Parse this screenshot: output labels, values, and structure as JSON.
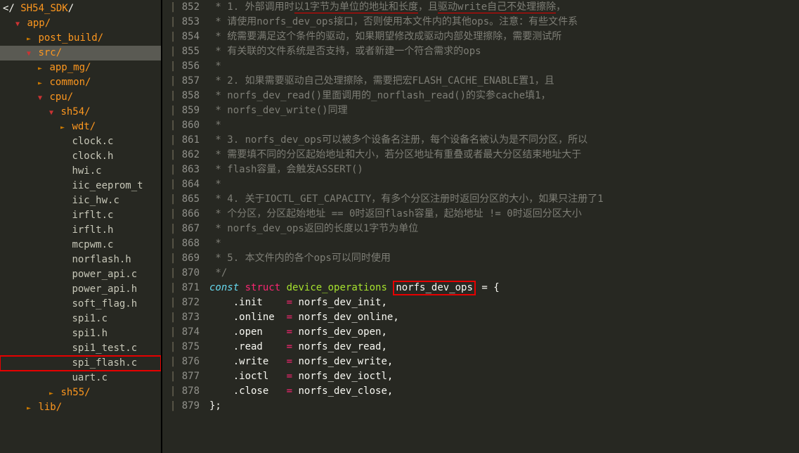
{
  "sidebar": {
    "root": "SH54_SDK",
    "root_prefix": "</ ",
    "root_suffix": "/",
    "items": [
      {
        "depth": 1,
        "arrow": "open",
        "kind": "dir",
        "label": "app/"
      },
      {
        "depth": 2,
        "arrow": "closed",
        "kind": "dir",
        "label": "post_build/"
      },
      {
        "depth": 2,
        "arrow": "open",
        "kind": "dir",
        "label": "src/",
        "selected": true
      },
      {
        "depth": 3,
        "arrow": "closed",
        "kind": "dir",
        "label": "app_mg/"
      },
      {
        "depth": 3,
        "arrow": "closed",
        "kind": "dir",
        "label": "common/"
      },
      {
        "depth": 3,
        "arrow": "open",
        "kind": "dir",
        "label": "cpu/"
      },
      {
        "depth": 4,
        "arrow": "open",
        "kind": "dir",
        "label": "sh54/"
      },
      {
        "depth": 5,
        "arrow": "closed",
        "kind": "dir",
        "label": "wdt/"
      },
      {
        "depth": 5,
        "arrow": "none",
        "kind": "file",
        "label": "clock.c"
      },
      {
        "depth": 5,
        "arrow": "none",
        "kind": "file",
        "label": "clock.h"
      },
      {
        "depth": 5,
        "arrow": "none",
        "kind": "file",
        "label": "hwi.c"
      },
      {
        "depth": 5,
        "arrow": "none",
        "kind": "file",
        "label": "iic_eeprom_t"
      },
      {
        "depth": 5,
        "arrow": "none",
        "kind": "file",
        "label": "iic_hw.c"
      },
      {
        "depth": 5,
        "arrow": "none",
        "kind": "file",
        "label": "irflt.c"
      },
      {
        "depth": 5,
        "arrow": "none",
        "kind": "file",
        "label": "irflt.h"
      },
      {
        "depth": 5,
        "arrow": "none",
        "kind": "file",
        "label": "mcpwm.c"
      },
      {
        "depth": 5,
        "arrow": "none",
        "kind": "file",
        "label": "norflash.h"
      },
      {
        "depth": 5,
        "arrow": "none",
        "kind": "file",
        "label": "power_api.c"
      },
      {
        "depth": 5,
        "arrow": "none",
        "kind": "file",
        "label": "power_api.h"
      },
      {
        "depth": 5,
        "arrow": "none",
        "kind": "file",
        "label": "soft_flag.h"
      },
      {
        "depth": 5,
        "arrow": "none",
        "kind": "file",
        "label": "spi1.c"
      },
      {
        "depth": 5,
        "arrow": "none",
        "kind": "file",
        "label": "spi1.h"
      },
      {
        "depth": 5,
        "arrow": "none",
        "kind": "file",
        "label": "spi1_test.c"
      },
      {
        "depth": 5,
        "arrow": "none",
        "kind": "file",
        "label": "spi_flash.c",
        "boxed": true
      },
      {
        "depth": 5,
        "arrow": "none",
        "kind": "file",
        "label": "uart.c"
      },
      {
        "depth": 4,
        "arrow": "closed",
        "kind": "dir",
        "label": "sh55/"
      },
      {
        "depth": 2,
        "arrow": "closed",
        "kind": "dir",
        "label": "lib/"
      }
    ]
  },
  "gutter": {
    "first": 852,
    "last": 879
  },
  "code": {
    "lines": [
      {
        "type": "cmt",
        "segs": [
          {
            "t": " * 1. 外部调用时"
          },
          {
            "t": "以1字节为单位的地址和长度",
            "ul": true
          },
          {
            "t": "，且"
          },
          {
            "t": "驱动write自己不处理擦除",
            "ul": true
          },
          {
            "t": "，"
          }
        ]
      },
      {
        "type": "cmt",
        "text": " * 请使用norfs_dev_ops接口，否则使用本文件内的其他ops。注意：有些文件系"
      },
      {
        "type": "cmt",
        "text": " * 统需要满足这个条件的驱动，如果期望修改成驱动内部处理擦除，需要测试所"
      },
      {
        "type": "cmt",
        "text": " * 有关联的文件系统是否支持，或者新建一个符合需求的ops"
      },
      {
        "type": "cmt",
        "text": " *"
      },
      {
        "type": "cmt",
        "text": " * 2. 如果需要驱动自己处理擦除，需要把宏FLASH_CACHE_ENABLE置1，且"
      },
      {
        "type": "cmt",
        "text": " * norfs_dev_read()里面调用的_norflash_read()的实参cache填1，"
      },
      {
        "type": "cmt",
        "text": " * norfs_dev_write()同理"
      },
      {
        "type": "cmt",
        "text": " *"
      },
      {
        "type": "cmt",
        "text": " * 3. norfs_dev_ops可以被多个设备名注册，每个设备名被认为是不同分区，所以"
      },
      {
        "type": "cmt",
        "text": " * 需要填不同的分区起始地址和大小，若分区地址有重叠或者最大分区结束地址大于"
      },
      {
        "type": "cmt",
        "text": " * flash容量，会触发ASSERT()"
      },
      {
        "type": "cmt",
        "text": " *"
      },
      {
        "type": "cmt",
        "text": " * 4. 关于IOCTL_GET_CAPACITY，有多个分区注册时返回分区的大小，如果只注册了1"
      },
      {
        "type": "cmt",
        "text": " * 个分区，分区起始地址 == 0时返回flash容量，起始地址 != 0时返回分区大小"
      },
      {
        "type": "cmt",
        "text": " * norfs_dev_ops返回的长度以1字节为单位"
      },
      {
        "type": "cmt",
        "text": " *"
      },
      {
        "type": "cmt",
        "text": " * 5. 本文件内的各个ops可以同时使用"
      },
      {
        "type": "cmt",
        "text": " */"
      },
      {
        "type": "decl",
        "const": "const",
        "struct": "struct",
        "typename": "device_operations",
        "var": "norfs_dev_ops",
        "boxed_var": true,
        "tail": " = {"
      },
      {
        "type": "field",
        "name": ".init",
        "pad": "   ",
        "val": "norfs_dev_init"
      },
      {
        "type": "field",
        "name": ".online",
        "pad": " ",
        "val": "norfs_dev_online"
      },
      {
        "type": "field",
        "name": ".open",
        "pad": "   ",
        "val": "norfs_dev_open"
      },
      {
        "type": "field",
        "name": ".read",
        "pad": "   ",
        "val": "norfs_dev_read"
      },
      {
        "type": "field",
        "name": ".write",
        "pad": "  ",
        "val": "norfs_dev_write"
      },
      {
        "type": "field",
        "name": ".ioctl",
        "pad": "  ",
        "val": "norfs_dev_ioctl"
      },
      {
        "type": "field",
        "name": ".close",
        "pad": "  ",
        "val": "norfs_dev_close"
      },
      {
        "type": "close",
        "text": "};"
      }
    ]
  }
}
